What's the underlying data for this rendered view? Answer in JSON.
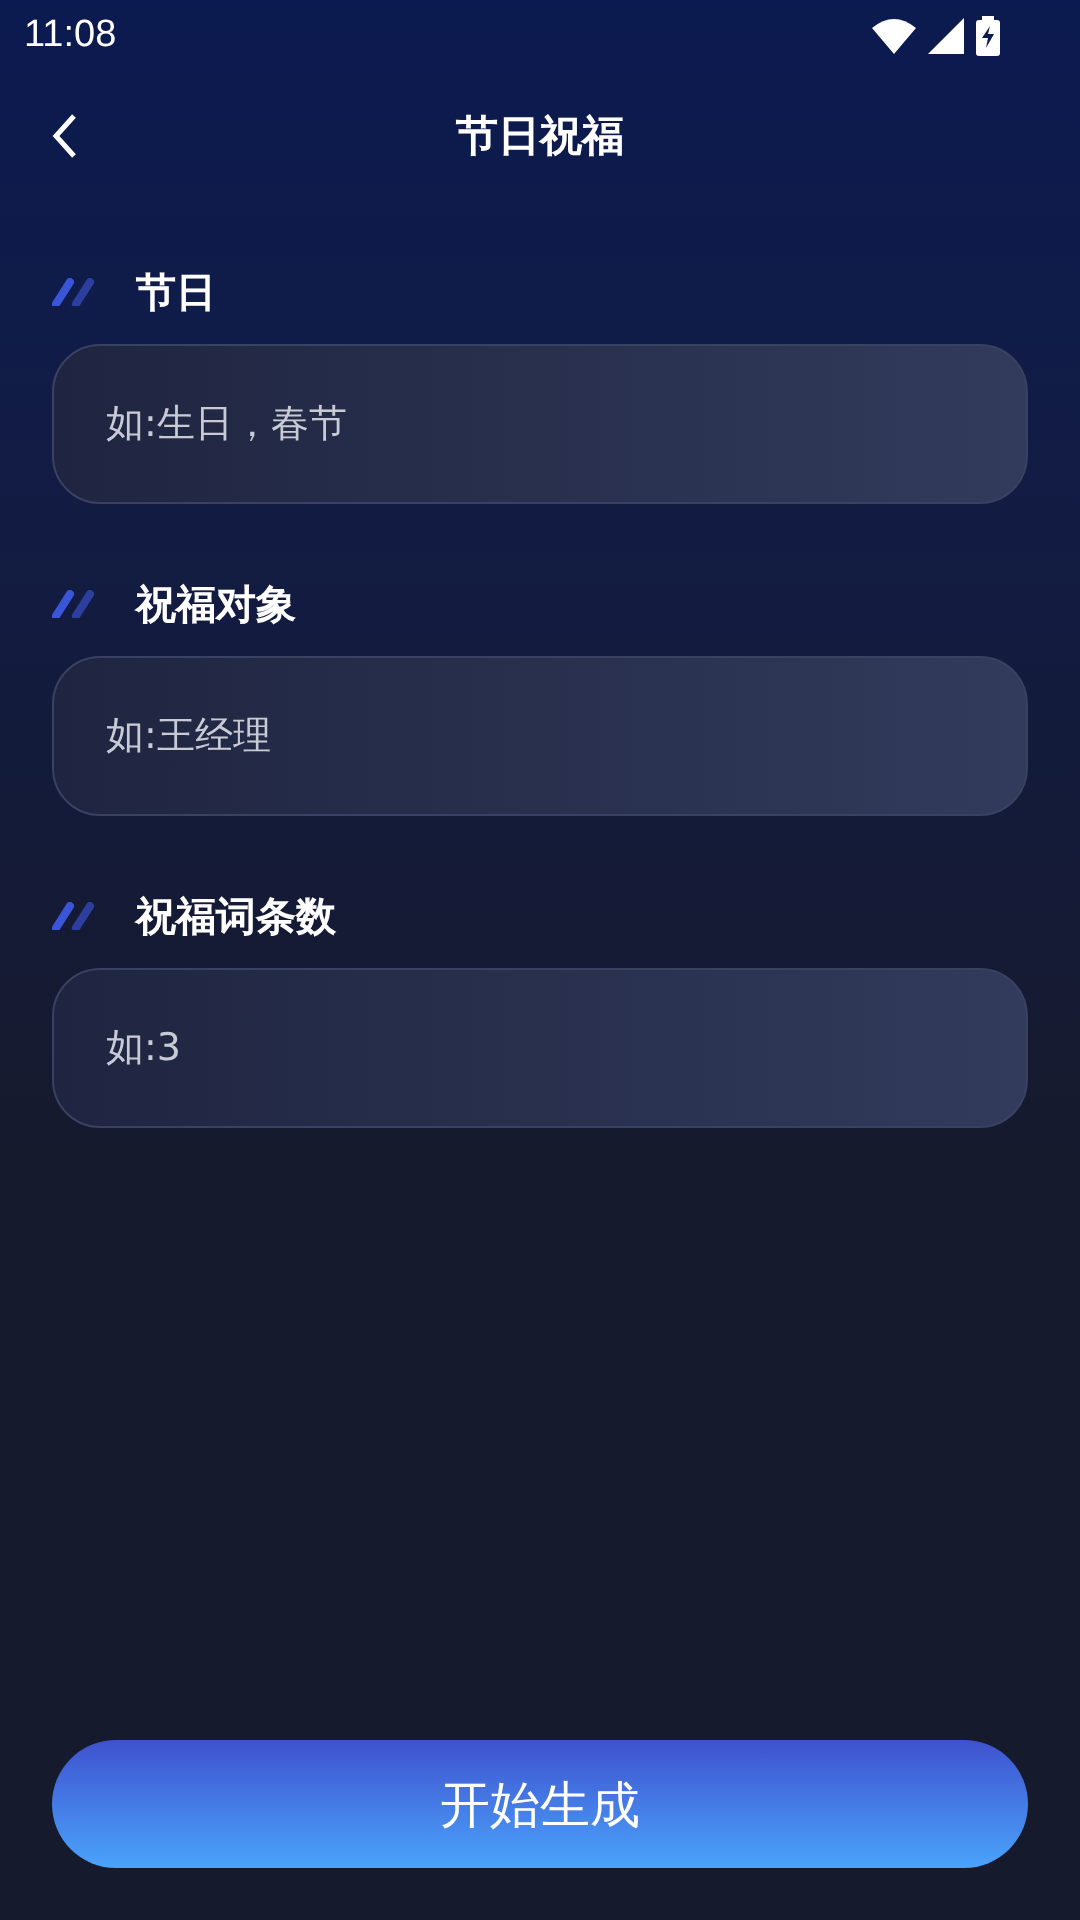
{
  "status_bar": {
    "time": "11:08"
  },
  "header": {
    "title": "节日祝福"
  },
  "fields": [
    {
      "label": "节日",
      "placeholder": "如:生日，春节"
    },
    {
      "label": "祝福对象",
      "placeholder": "如:王经理"
    },
    {
      "label": "祝福词条数",
      "placeholder": "如:3"
    }
  ],
  "submit_button": {
    "label": "开始生成"
  }
}
